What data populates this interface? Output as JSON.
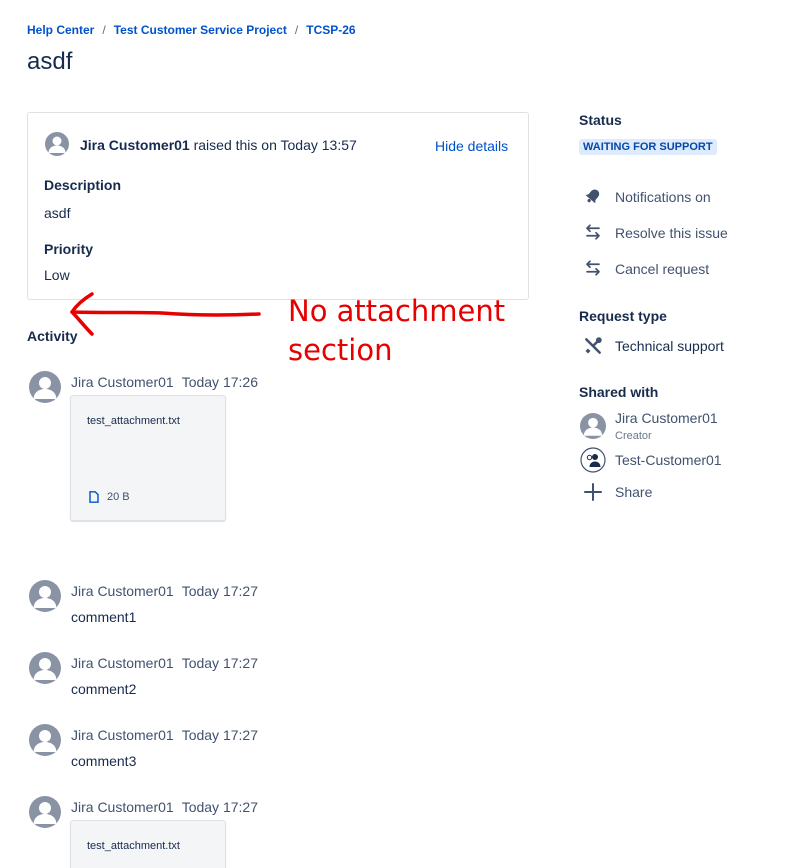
{
  "breadcrumb": {
    "items": [
      "Help Center",
      "Test Customer Service Project",
      "TCSP-26"
    ],
    "separator": "/"
  },
  "issue": {
    "title": "asdf",
    "reporter": "Jira Customer01",
    "raised_text": "raised this on Today 13:57",
    "hide_details": "Hide details",
    "description_label": "Description",
    "description": "asdf",
    "priority_label": "Priority",
    "priority": "Low"
  },
  "annotation": {
    "line1": "No attachment",
    "line2": "section",
    "color": "#e60000"
  },
  "activity": {
    "heading": "Activity",
    "entries": [
      {
        "author": "Jira Customer01",
        "time": "Today 17:26",
        "attachment": {
          "name": "test_attachment.txt",
          "size": "20 B"
        }
      },
      {
        "author": "Jira Customer01",
        "time": "Today 17:27",
        "text": "comment1"
      },
      {
        "author": "Jira Customer01",
        "time": "Today 17:27",
        "text": "comment2"
      },
      {
        "author": "Jira Customer01",
        "time": "Today 17:27",
        "text": "comment3"
      },
      {
        "author": "Jira Customer01",
        "time": "Today 17:27",
        "attachment": {
          "name": "test_attachment.txt"
        }
      }
    ]
  },
  "sidebar": {
    "status_label": "Status",
    "status_value": "WAITING FOR SUPPORT",
    "actions": [
      {
        "icon": "bell-icon",
        "label": "Notifications on"
      },
      {
        "icon": "transition-icon",
        "label": "Resolve this issue"
      },
      {
        "icon": "transition-icon",
        "label": "Cancel request"
      }
    ],
    "request_type_label": "Request type",
    "request_type": {
      "icon": "tools-icon",
      "label": "Technical support"
    },
    "shared_with_label": "Shared with",
    "shared_with": [
      {
        "name": "Jira Customer01",
        "role": "Creator"
      },
      {
        "name": "Test-Customer01"
      }
    ],
    "share_label": "Share"
  },
  "colors": {
    "link": "#0052cc",
    "text": "#172b4d",
    "muted": "#42526e",
    "avatar": "#8993a4",
    "lozenge_bg": "#deebff",
    "lozenge_text": "#0747a6"
  }
}
